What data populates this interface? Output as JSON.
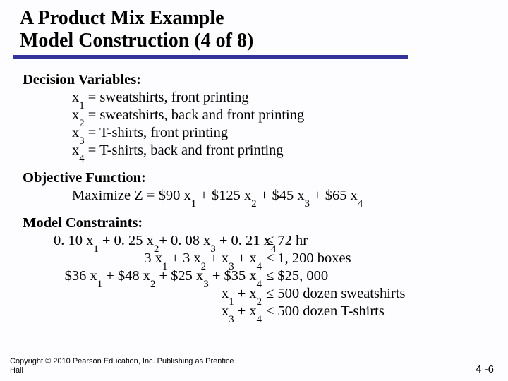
{
  "title": {
    "line1": "A Product Mix Example",
    "line2": "Model Construction (4 of 8)"
  },
  "dv": {
    "heading": "Decision Variables:",
    "x1": " = sweatshirts,  front printing",
    "x2": " = sweatshirts, back and front printing",
    "x3": " = T-shirts, front printing",
    "x4": " = T-shirts, back and front printing"
  },
  "obj": {
    "heading": "Objective Function:",
    "pre": "Maximize Z = $90 x",
    "mid1": " + $125 x",
    "mid2": " + $45 x",
    "mid3": " + $65 x"
  },
  "con": {
    "heading": "Model Constraints:",
    "r1_lhs_a": "0. 10 x",
    "r1_lhs_b": " + 0. 25 x",
    "r1_lhs_c": "+ 0. 08 x",
    "r1_lhs_d": " + 0. 21 x",
    "r1_rhs": " ≤ 72 hr",
    "r2_lhs_a": "3 x",
    "r2_lhs_b": " + 3 x",
    "r2_lhs_c": " + x",
    "r2_lhs_d": " + x",
    "r2_rhs": " ≤ 1, 200 boxes",
    "r3_lhs_a": "$36 x",
    "r3_lhs_b": " + $48 x",
    "r3_lhs_c": " + $25 x",
    "r3_lhs_d": " + $35 x",
    "r3_rhs": " ≤ $25, 000",
    "r4_lhs_a": "x",
    "r4_lhs_b": " + x",
    "r4_rhs": " ≤ 500 dozen sweatshirts",
    "r5_lhs_a": "x",
    "r5_lhs_b": " + x",
    "r5_rhs": " ≤ 500 dozen T-shirts"
  },
  "footer": {
    "line1": "Copyright © 2010 Pearson Education, Inc. Publishing as Prentice",
    "line2": "Hall"
  },
  "pagenum": "4 -6"
}
